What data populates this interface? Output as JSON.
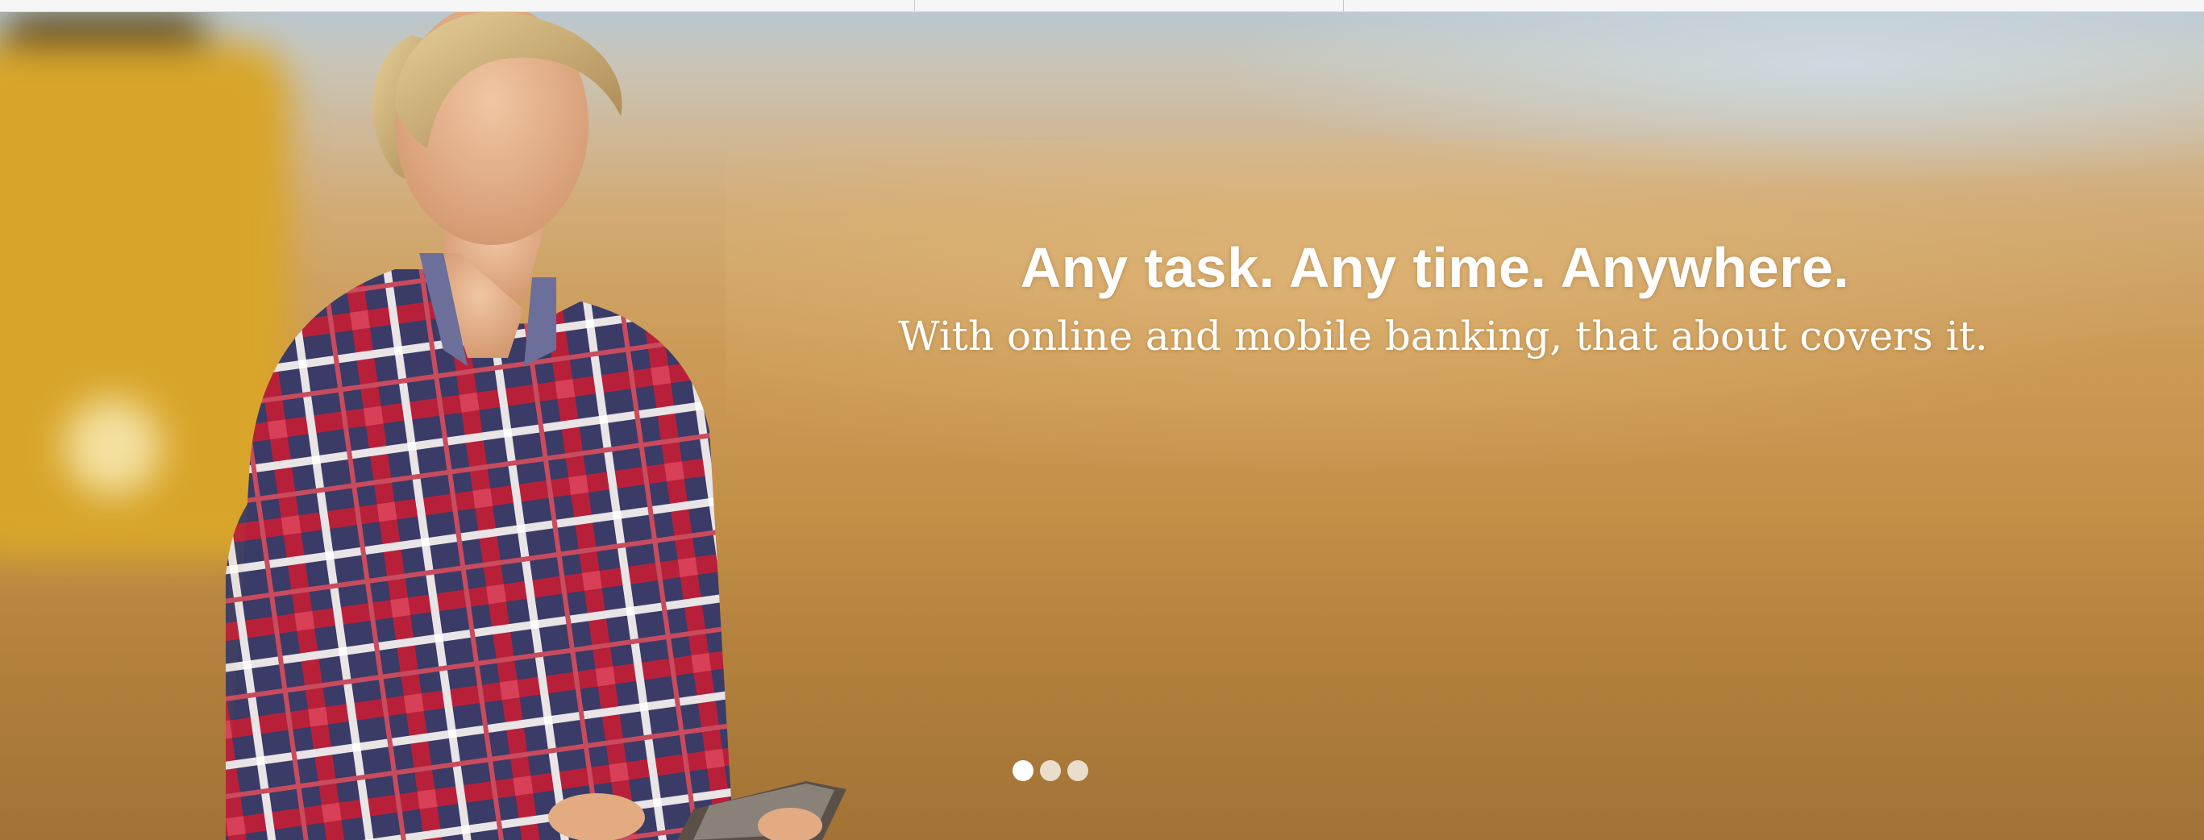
{
  "hero": {
    "headline": "Any task. Any time. Anywhere.",
    "subheadline": "With online and mobile banking, that about covers it.",
    "image_subject": "woman-with-tablet-in-wheat-field"
  },
  "carousel": {
    "slide_count": 3,
    "active_index": 0
  },
  "colors": {
    "headline_text": "#ffffff",
    "field_gold": "#c9984f",
    "sky": "#b9c7cf"
  }
}
